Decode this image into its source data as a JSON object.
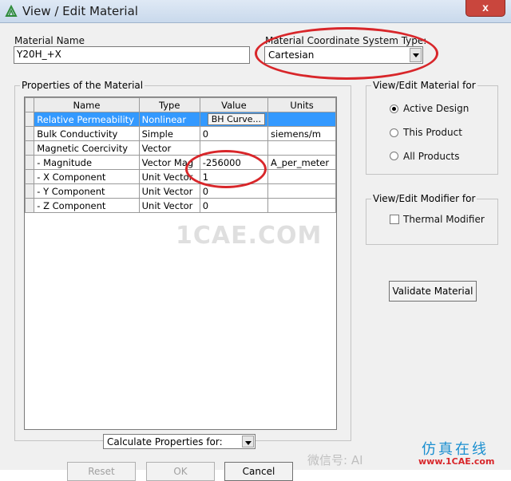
{
  "window": {
    "title": "View / Edit Material",
    "close_label": "x"
  },
  "material_name": {
    "label": "Material Name",
    "value": "Y20H_+X"
  },
  "coordinate_system": {
    "label": "Material Coordinate System Type:",
    "value": "Cartesian"
  },
  "properties": {
    "group_title": "Properties of the Material",
    "columns": [
      "Name",
      "Type",
      "Value",
      "Units"
    ],
    "rows": [
      {
        "name": "Relative Permeability",
        "type": "Nonlinear",
        "value": "BH Curve...",
        "units": ""
      },
      {
        "name": "Bulk Conductivity",
        "type": "Simple",
        "value": "0",
        "units": "siemens/m"
      },
      {
        "name": "Magnetic Coercivity",
        "type": "Vector",
        "value": "",
        "units": ""
      },
      {
        "name": "- Magnitude",
        "type": "Vector Mag",
        "value": "-256000",
        "units": "A_per_meter"
      },
      {
        "name": "- X Component",
        "type": "Unit Vector",
        "value": "1",
        "units": ""
      },
      {
        "name": "- Y Component",
        "type": "Unit Vector",
        "value": "0",
        "units": ""
      },
      {
        "name": "- Z Component",
        "type": "Unit Vector",
        "value": "0",
        "units": ""
      }
    ]
  },
  "edit_for": {
    "group_title": "View/Edit Material for",
    "options": [
      "Active Design",
      "This Product",
      "All Products"
    ],
    "selected": "Active Design"
  },
  "modifier": {
    "group_title": "View/Edit Modifier for",
    "checkbox_label": "Thermal Modifier",
    "checked": false
  },
  "validate_button": "Validate Material",
  "calculate": {
    "value": "Calculate Properties for:"
  },
  "buttons": {
    "reset": "Reset",
    "ok": "OK",
    "cancel": "Cancel"
  },
  "watermarks": {
    "center": "1CAE.COM",
    "wechat": "微信号: AI",
    "brand": "仿真在线",
    "url": "www.1CAE.com"
  },
  "colors": {
    "selection": "#3399ff",
    "highlight": "#d8262a"
  }
}
